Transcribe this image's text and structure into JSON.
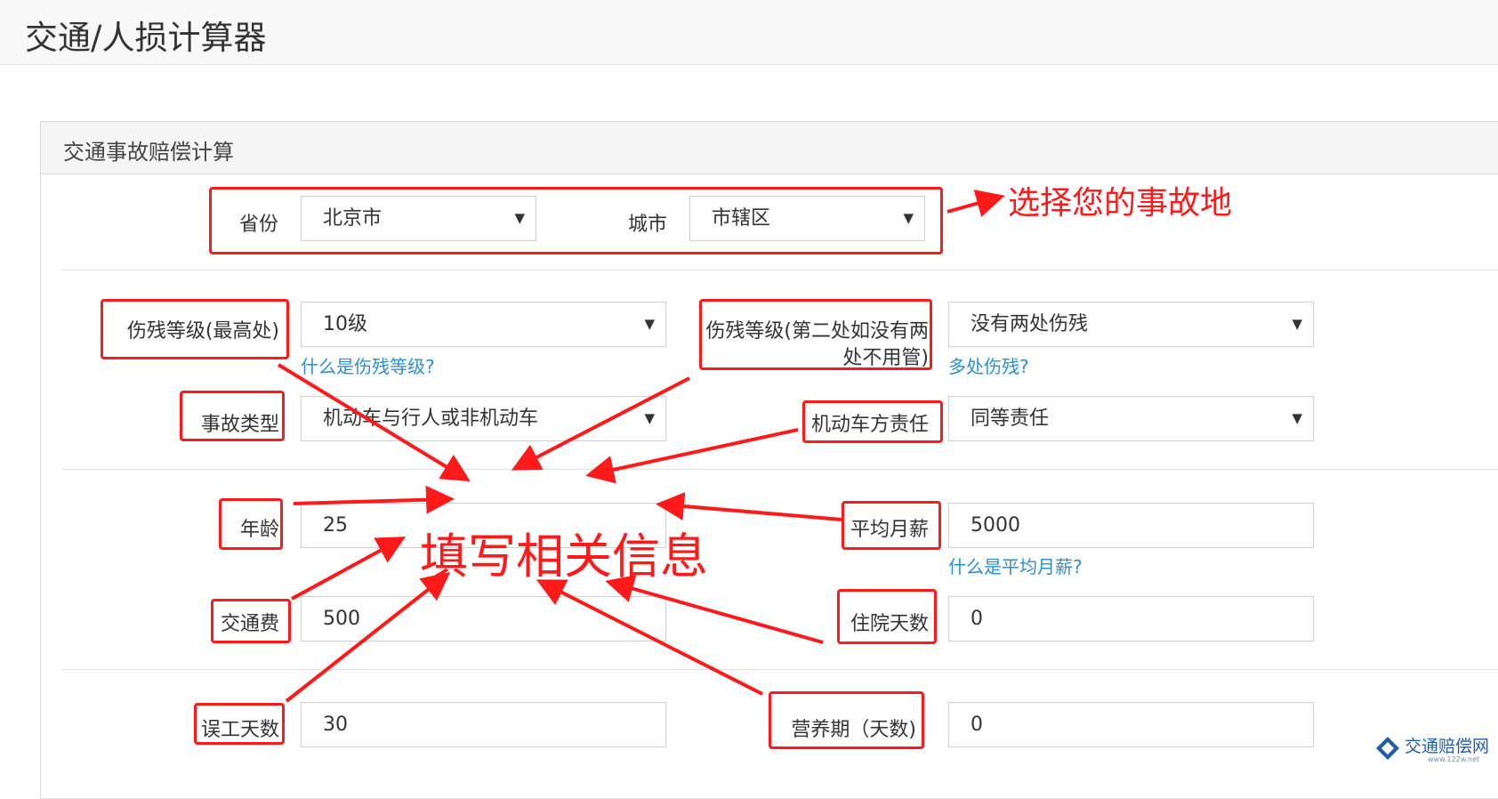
{
  "app": {
    "title": "交通/人损计算器"
  },
  "panel": {
    "title": "交通事故赔偿计算"
  },
  "location": {
    "province_label": "省份",
    "province_value": "北京市",
    "city_label": "城市",
    "city_value": "市辖区"
  },
  "disability": {
    "primary_label": "伤残等级(最高处)",
    "primary_value": "10级",
    "primary_help": "什么是伤残等级?",
    "secondary_label_line1": "伤残等级(第二处如没有两",
    "secondary_label_line2": "处不用管)",
    "secondary_value": "没有两处伤残",
    "secondary_help": "多处伤残?"
  },
  "accident": {
    "type_label": "事故类型",
    "type_value": "机动车与行人或非机动车",
    "responsibility_label": "机动车方责任",
    "responsibility_value": "同等责任"
  },
  "inputs": {
    "age_label": "年龄",
    "age_value": "25",
    "salary_label": "平均月薪",
    "salary_value": "5000",
    "salary_help": "什么是平均月薪?",
    "transport_label": "交通费",
    "transport_value": "500",
    "hospital_label": "住院天数",
    "hospital_value": "0",
    "lost_work_label": "误工天数",
    "lost_work_value": "30",
    "nutrition_label": "营养期（天数)",
    "nutrition_value": "0"
  },
  "annotations": {
    "select_location": "选择您的事故地",
    "fill_info": "填写相关信息",
    "color": "#ff1a1a"
  },
  "watermark": {
    "name": "交通赔偿网",
    "url": "www.122w.net"
  },
  "icons": {
    "dropdown": "▼"
  }
}
